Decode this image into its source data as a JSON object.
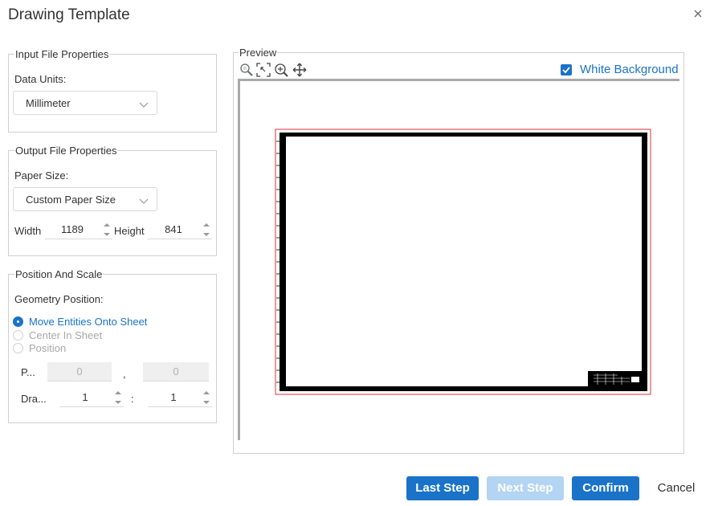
{
  "dialog": {
    "title": "Drawing Template"
  },
  "input_props": {
    "legend": "Input File Properties",
    "data_units_label": "Data Units:",
    "data_units_value": "Millimeter"
  },
  "output_props": {
    "legend": "Output File Properties",
    "paper_size_label": "Paper Size:",
    "paper_size_value": "Custom Paper Size",
    "width_label": "Width",
    "width_value": "1189",
    "height_label": "Height",
    "height_value": "841"
  },
  "position_scale": {
    "legend": "Position And Scale",
    "geometry_position_label": "Geometry Position:",
    "options": [
      {
        "label": "Move Entities Onto Sheet",
        "selected": true
      },
      {
        "label": "Center In Sheet",
        "selected": false
      },
      {
        "label": "Position",
        "selected": false
      }
    ],
    "pos_label": "P...",
    "pos_x": "0",
    "pos_sep": ",",
    "pos_y": "0",
    "draw_label": "Dra...",
    "draw_a": "1",
    "draw_sep": ":",
    "draw_b": "1"
  },
  "preview": {
    "legend": "Preview",
    "tools": [
      "zoom-icon",
      "zoom-extents-icon",
      "zoom-window-icon",
      "pan-icon"
    ],
    "white_background_label": "White Background",
    "white_background_checked": true
  },
  "buttons": {
    "last_step": "Last Step",
    "next_step": "Next Step",
    "confirm": "Confirm",
    "cancel": "Cancel"
  },
  "colors": {
    "accent": "#1a73c9",
    "accent_disabled": "#b3d4f2",
    "sheet_border": "#000000",
    "sheet_outline": "#e0303a"
  }
}
